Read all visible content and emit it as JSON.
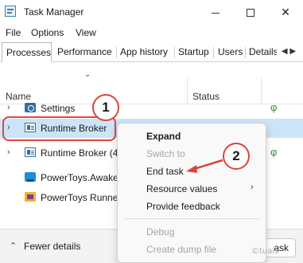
{
  "window": {
    "title": "Task Manager",
    "app_icon": "task-manager-icon",
    "minimize_icon": "minimize-icon",
    "maximize_icon": "maximize-icon",
    "close_glyph": "✕"
  },
  "menu": {
    "items": [
      {
        "label": "File"
      },
      {
        "label": "Options"
      },
      {
        "label": "View"
      }
    ]
  },
  "tabs": [
    {
      "label": "Processes",
      "active": true
    },
    {
      "label": "Performance"
    },
    {
      "label": "App history"
    },
    {
      "label": "Startup"
    },
    {
      "label": "Users"
    },
    {
      "label": "Details"
    }
  ],
  "tab_scroll": "◀ ▶",
  "table": {
    "sort_indicator": "⌄",
    "columns": {
      "name": "Name",
      "status": "Status"
    },
    "rows": [
      {
        "name": "Settings",
        "icon": "settings-icon",
        "expander": "›",
        "status_icon": "leaf-icon"
      },
      {
        "name": "Runtime Broker",
        "icon": "runtime-broker-icon",
        "expander": "›",
        "selected": true
      },
      {
        "name": "Runtime Broker (4",
        "icon": "runtime-broker-icon",
        "expander": "›",
        "status_icon": "leaf-icon"
      },
      {
        "name": "PowerToys.Awake",
        "icon": "powertoys-awake-icon",
        "expander": ""
      },
      {
        "name": "PowerToys Runner",
        "icon": "powertoys-runner-icon",
        "expander": ""
      }
    ],
    "leaf_glyph": "φ"
  },
  "context_menu": {
    "items": [
      {
        "label": "Expand",
        "bold": true
      },
      {
        "label": "Switch to",
        "disabled": true
      },
      {
        "label": "End task"
      },
      {
        "label": "Resource values",
        "submenu_glyph": "›"
      },
      {
        "label": "Provide feedback"
      },
      {
        "label": "Debug",
        "disabled": true
      },
      {
        "label": "Create dump file",
        "disabled": true
      }
    ]
  },
  "footer": {
    "chevron": "⌃",
    "fewer_details": "Fewer details",
    "end_task_button": "ask"
  },
  "callouts": {
    "step1": "1",
    "step2": "2",
    "color": "#d9463a"
  },
  "watermark": "©tuals"
}
